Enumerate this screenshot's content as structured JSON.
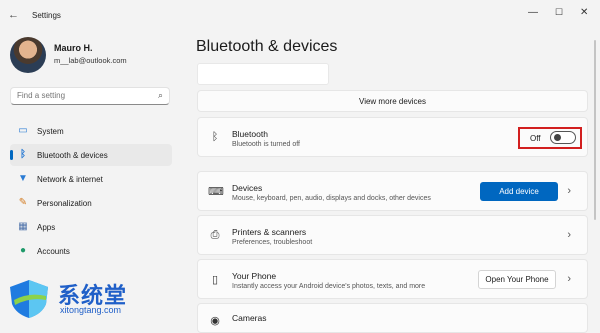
{
  "window": {
    "title": "Settings",
    "back_icon": "back-arrow-icon",
    "controls": {
      "minimize": "—",
      "maximize": "☐",
      "close": "✕"
    }
  },
  "user": {
    "name": "Mauro H.",
    "email": "m__lab@outlook.com"
  },
  "search": {
    "placeholder": "Find a setting",
    "value": ""
  },
  "nav": [
    {
      "label": "System",
      "icon": "monitor-icon",
      "active": false
    },
    {
      "label": "Bluetooth & devices",
      "icon": "bluetooth-icon",
      "active": true
    },
    {
      "label": "Network & internet",
      "icon": "wifi-icon",
      "active": false
    },
    {
      "label": "Personalization",
      "icon": "brush-icon",
      "active": false
    },
    {
      "label": "Apps",
      "icon": "apps-icon",
      "active": false
    },
    {
      "label": "Accounts",
      "icon": "person-icon",
      "active": false
    }
  ],
  "page": {
    "title": "Bluetooth & devices"
  },
  "view_more": "View more devices",
  "bluetooth": {
    "title": "Bluetooth",
    "subtitle": "Bluetooth is turned off",
    "state": "Off",
    "enabled": false
  },
  "rows": {
    "devices": {
      "title": "Devices",
      "subtitle": "Mouse, keyboard, pen, audio, displays and docks, other devices",
      "button": "Add device"
    },
    "printers": {
      "title": "Printers & scanners",
      "subtitle": "Preferences, troubleshoot"
    },
    "phone": {
      "title": "Your Phone",
      "subtitle": "Instantly access your Android device's photos, texts, and more",
      "button": "Open Your Phone"
    },
    "cameras": {
      "title": "Cameras"
    }
  },
  "watermark": {
    "chinese": "系统堂",
    "url": "xitongtang.com"
  },
  "colors": {
    "accent": "#0067c0",
    "highlight_border": "#d21f1f"
  }
}
